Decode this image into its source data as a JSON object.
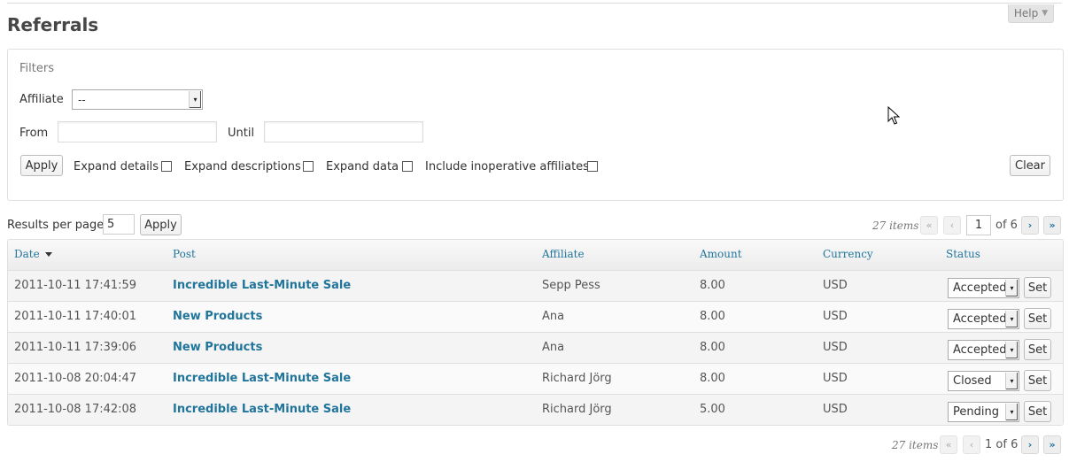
{
  "header": {
    "title": "Referrals",
    "help_label": "Help",
    "help_caret": "▼"
  },
  "filters": {
    "legend": "Filters",
    "affiliate_label": "Affiliate",
    "affiliate_value": "--",
    "from_label": "From",
    "from_value": "",
    "until_label": "Until",
    "until_value": "",
    "apply_label": "Apply",
    "clear_label": "Clear",
    "options": [
      {
        "label": "Expand details",
        "checked": false
      },
      {
        "label": "Expand descriptions",
        "checked": false
      },
      {
        "label": "Expand data",
        "checked": false
      },
      {
        "label": "Include inoperative affiliates",
        "checked": false
      }
    ]
  },
  "results": {
    "per_page_label": "Results per page",
    "per_page_value": "5",
    "apply_label": "Apply"
  },
  "pagination": {
    "items_count": "27 items",
    "first": "«",
    "prev": "‹",
    "next": "›",
    "last": "»",
    "current_page": "1",
    "of_label": "of 6",
    "bottom_label": "1 of 6"
  },
  "table": {
    "columns": [
      "Date",
      "Post",
      "Affiliate",
      "Amount",
      "Currency",
      "Status"
    ],
    "set_label": "Set",
    "rows": [
      {
        "date": "2011-10-11 17:41:59",
        "post": "Incredible Last-Minute Sale",
        "affiliate": "Sepp Pess",
        "amount": "8.00",
        "currency": "USD",
        "status": "Accepted"
      },
      {
        "date": "2011-10-11 17:40:01",
        "post": "New Products",
        "affiliate": "Ana",
        "amount": "8.00",
        "currency": "USD",
        "status": "Accepted"
      },
      {
        "date": "2011-10-11 17:39:06",
        "post": "New Products",
        "affiliate": "Ana",
        "amount": "8.00",
        "currency": "USD",
        "status": "Accepted"
      },
      {
        "date": "2011-10-08 20:04:47",
        "post": "Incredible Last-Minute Sale",
        "affiliate": "Richard Jörg",
        "amount": "8.00",
        "currency": "USD",
        "status": "Closed"
      },
      {
        "date": "2011-10-08 17:42:08",
        "post": "Incredible Last-Minute Sale",
        "affiliate": "Richard Jörg",
        "amount": "5.00",
        "currency": "USD",
        "status": "Pending"
      }
    ]
  },
  "icons": {
    "dropdown": "▾",
    "cursor": "mouse-pointer-icon"
  },
  "colors": {
    "link": "#21759b",
    "border": "#dfdfdf"
  }
}
